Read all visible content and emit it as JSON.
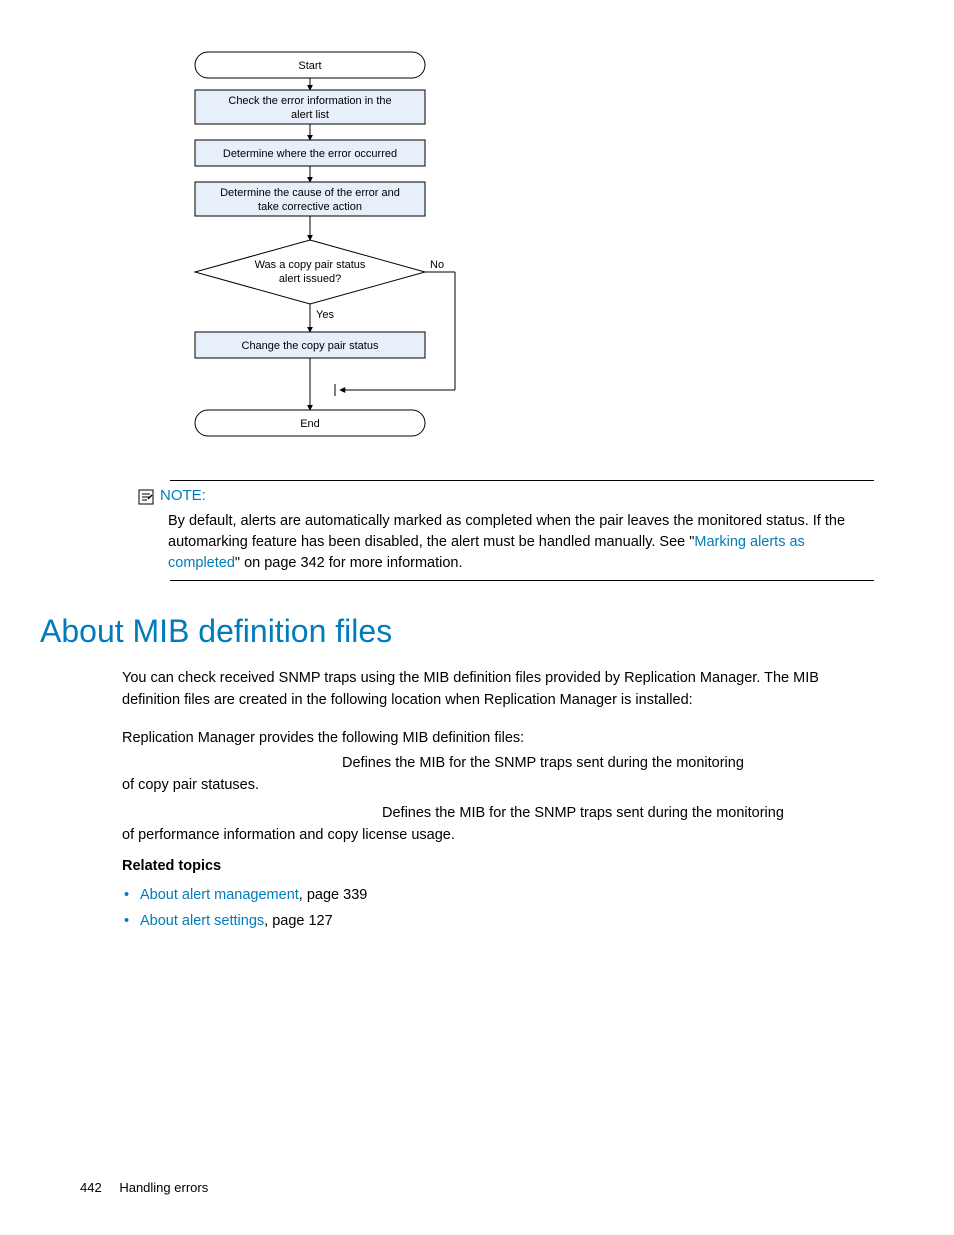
{
  "flowchart": {
    "start": "Start",
    "step1": "Check the error information in the alert list",
    "step2": "Determine where the error occurred",
    "step3": "Determine the cause of the error and take corrective action",
    "decision": "Was a copy pair status alert issued?",
    "decision_yes": "Yes",
    "decision_no": "No",
    "step4": "Change the copy pair status",
    "end": "End"
  },
  "note": {
    "label": "NOTE:",
    "body_pre": "By default, alerts are automatically marked as completed when the pair leaves the monitored status. If the automarking feature has been disabled, the alert must be handled manually. See \"",
    "link": "Marking alerts as completed",
    "body_post": "\" on page 342 for more information."
  },
  "section": {
    "heading": "About MIB definition files",
    "p1": "You can check received SNMP traps using the MIB definition files provided by Replication Manager. The MIB definition files are created in the following location when Replication Manager is installed:",
    "p2": "Replication Manager provides the following MIB definition files:",
    "mib1_def": "Defines the MIB for the SNMP traps sent during the monitoring of copy pair statuses.",
    "mib2_def": "Defines the MIB for the SNMP traps sent during the monitoring of performance information and copy license usage."
  },
  "related": {
    "heading": "Related topics",
    "items": [
      {
        "link": "About alert management",
        "suffix": ", page 339"
      },
      {
        "link": "About alert settings",
        "suffix": ", page 127"
      }
    ]
  },
  "footer": {
    "page": "442",
    "title": "Handling errors"
  }
}
